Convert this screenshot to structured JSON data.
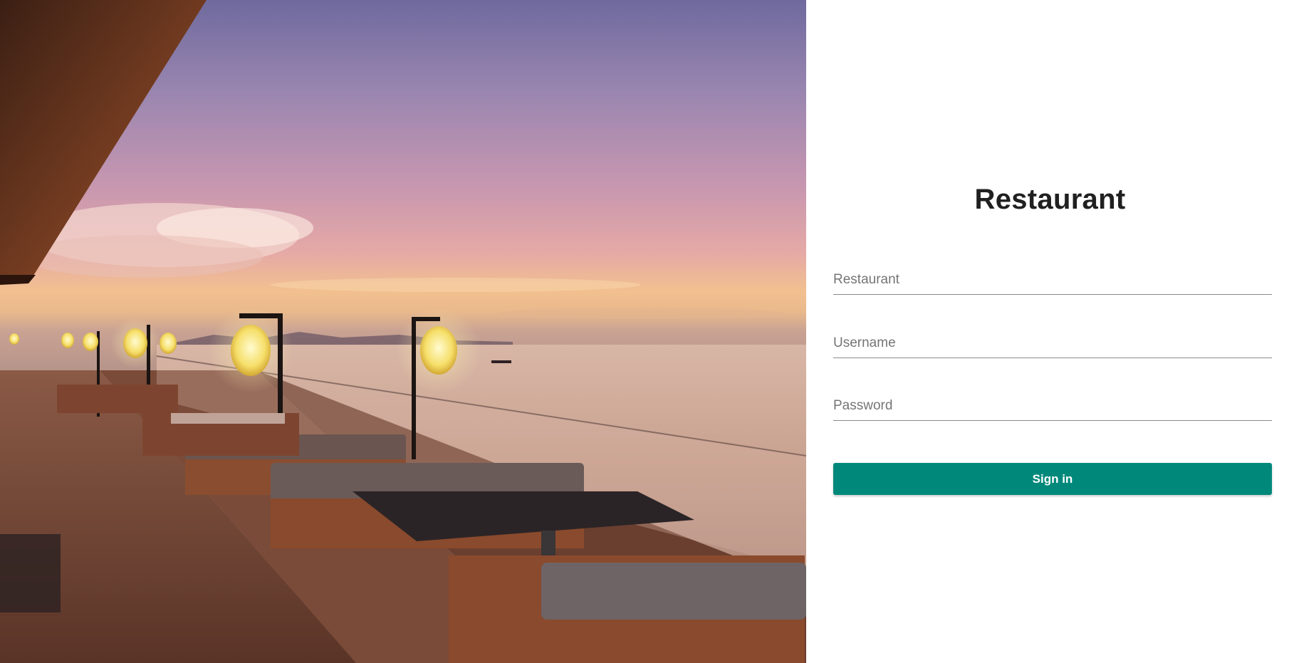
{
  "hero": {
    "image": "restaurant-terrace-sunset-photo"
  },
  "login": {
    "title": "Restaurant",
    "restaurant_placeholder": "Restaurant",
    "username_placeholder": "Username",
    "password_placeholder": "Password",
    "signin_label": "Sign in"
  },
  "colors": {
    "accent": "#00897b",
    "title": "#202020",
    "field_line": "#8a8a8a",
    "placeholder": "#757575"
  }
}
